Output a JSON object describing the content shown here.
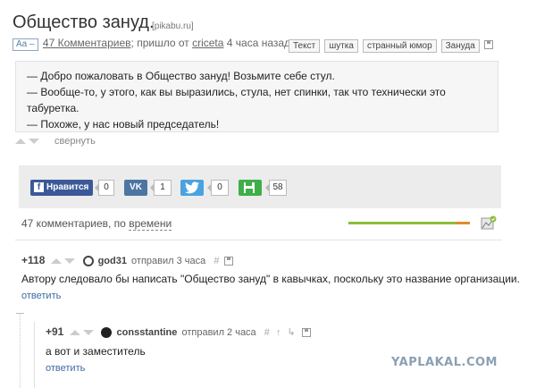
{
  "post": {
    "title": "Общество зануд.",
    "domain": "[pikabu.ru]",
    "font_button": "Aa –",
    "comments_link": "47 Комментариев",
    "came_from_prefix": "; пришло от ",
    "author": "criceta",
    "time_ago": " 4 часа назад",
    "tags": [
      "Текст",
      "шутка",
      "странный юмор",
      "Зануда"
    ]
  },
  "quote_lines": [
    "— Добро пожаловать в Общество зануд! Возьмите себе стул.",
    "— Вообще-то, у этого, как вы выразились, стула, нет спинки, так что технически это",
    "табуретка.",
    "— Похоже, у нас новый председатель!"
  ],
  "collapse_label": "свернуть",
  "share": {
    "facebook": {
      "label": "Нравится",
      "count": "0",
      "color": "#3b5998"
    },
    "vk": {
      "label": "VK",
      "count": "1",
      "color": "#4c75a3"
    },
    "twitter": {
      "label": "t",
      "count": "0",
      "color": "#4aa3df"
    },
    "save": {
      "label": "save",
      "count": "58",
      "color": "#3fae49"
    }
  },
  "comments_header": {
    "count_text": "47 комментариев, по ",
    "sort_link": "времени",
    "rating_positive": 0.88
  },
  "comments": [
    {
      "rating": "+118",
      "author": "god31",
      "sent": "отправил 3 часа",
      "text": "Автору следовало бы написать \"Общество зануд\" в кавычках, поскольку это название организации.",
      "reply": "ответить"
    },
    {
      "rating": "+91",
      "author": "consstantine",
      "sent": "отправил 2 часа",
      "text": "а вот и заместитель",
      "reply": "ответить"
    }
  ],
  "watermark": "YAPLAKAL.COM",
  "colors": {
    "link": "#3d6aa2",
    "rating_pos": "#8cbd3b",
    "rating_neg": "#e48a2b"
  }
}
